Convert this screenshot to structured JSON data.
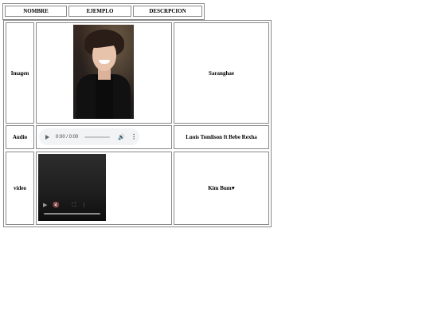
{
  "header": {
    "columns": [
      "NOMBRE",
      "EJEMPLO",
      "DESCRPCION"
    ]
  },
  "rows": [
    {
      "label": "Imagen",
      "example": {
        "kind": "image",
        "icon": "portrait-photo"
      },
      "description": "Saranghae"
    },
    {
      "label": "Audio",
      "example": {
        "kind": "audio",
        "time": "0:00 / 0:00"
      },
      "description": "Luois Tomlison ft Bebe Rexha"
    },
    {
      "label": "video",
      "example": {
        "kind": "video"
      },
      "description": "Kim Bum♥"
    }
  ],
  "colors": {
    "border": "#8a8a8a",
    "audio_bg": "#f1f3f4",
    "video_bg": "#1e1e1e"
  }
}
